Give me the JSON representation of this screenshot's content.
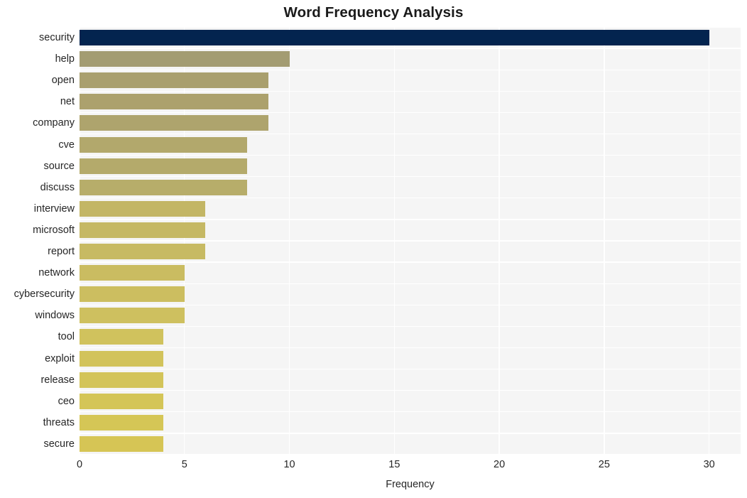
{
  "chart_data": {
    "type": "bar",
    "orientation": "horizontal",
    "title": "Word Frequency Analysis",
    "xlabel": "Frequency",
    "ylabel": "",
    "categories": [
      "security",
      "help",
      "open",
      "net",
      "company",
      "cve",
      "source",
      "discuss",
      "interview",
      "microsoft",
      "report",
      "network",
      "cybersecurity",
      "windows",
      "tool",
      "exploit",
      "release",
      "ceo",
      "threats",
      "secure"
    ],
    "values": [
      30,
      10,
      9,
      9,
      9,
      8,
      8,
      8,
      6,
      6,
      6,
      5,
      5,
      5,
      4,
      4,
      4,
      4,
      4,
      4
    ],
    "bar_colors": [
      "#03244f",
      "#a39c72",
      "#a99f6e",
      "#aca16d",
      "#aea46d",
      "#b2a86c",
      "#b4aa6b",
      "#b7ad6a",
      "#c3b665",
      "#c5b864",
      "#c7ba63",
      "#cabc61",
      "#ccbe60",
      "#cec05f",
      "#d0c25d",
      "#d2c35b",
      "#d3c459",
      "#d4c557",
      "#d5c656",
      "#d6c555"
    ],
    "xlim": [
      0,
      31.5
    ],
    "xticks": [
      0,
      5,
      10,
      15,
      20,
      25,
      30
    ],
    "xtick_labels": [
      "0",
      "5",
      "10",
      "15",
      "20",
      "25",
      "30"
    ],
    "grid": true,
    "grid_color": "#ffffff",
    "plot_background": "#f5f5f5",
    "figure_background": "#ffffff",
    "legend": null,
    "annotations": []
  }
}
